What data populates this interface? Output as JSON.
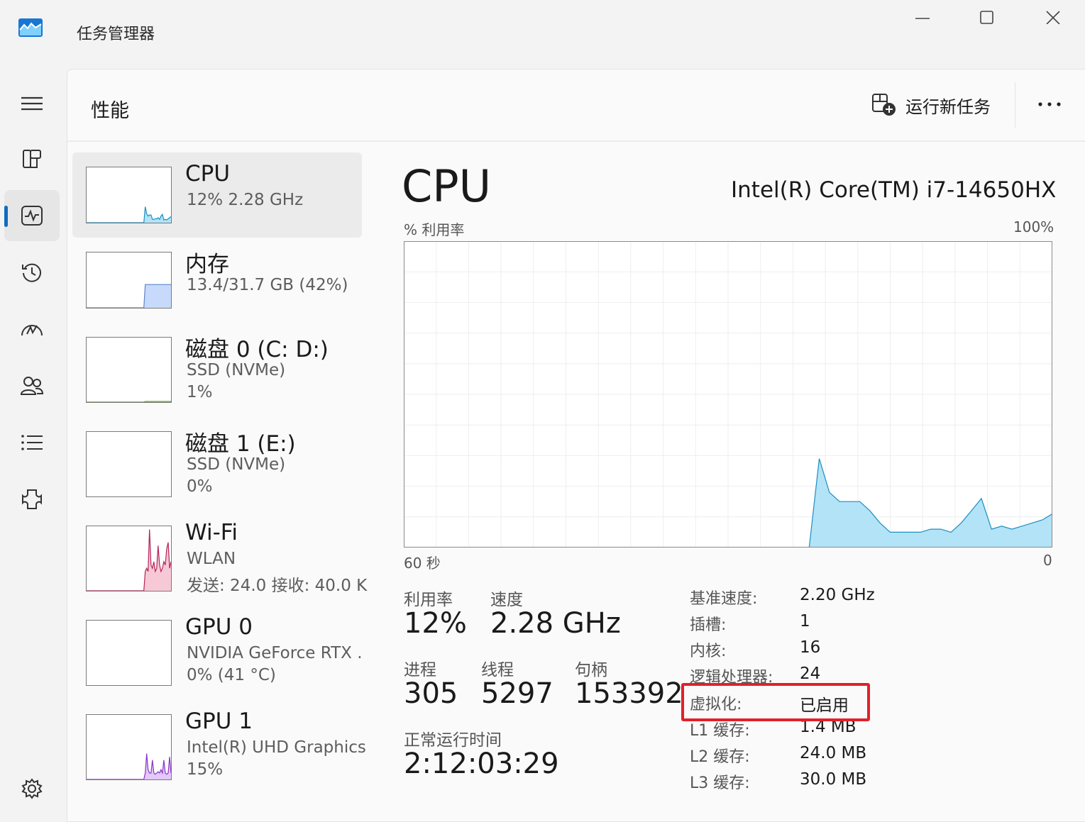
{
  "app": {
    "title": "任务管理器"
  },
  "icons": {
    "app": "task-manager-icon",
    "minimize": "minimize-icon",
    "maximize": "maximize-icon",
    "close": "close-icon",
    "menu": "hamburger-icon",
    "processes": "processes-icon",
    "performance": "performance-icon",
    "history": "app-history-icon",
    "startup": "startup-apps-icon",
    "users": "users-icon",
    "details": "details-icon",
    "services": "services-icon",
    "settings": "gear-icon",
    "run_task": "run-new-task-icon",
    "more": "more-options-icon"
  },
  "colors": {
    "accent": "#0f6cbd",
    "cpu_stroke": "#1c8fc0",
    "cpu_fill": "#b3e3f7",
    "memory_stroke": "#5b86c8",
    "memory_fill": "#c7dafc",
    "disk_stroke": "#4e9a06",
    "wifi_stroke": "#b4245a",
    "wifi_fill": "#f7c9d6",
    "gpu_stroke": "#8a33c7",
    "gpu_fill": "#e3c8f8",
    "highlight": "#e3202a"
  },
  "header": {
    "title": "性能",
    "run_new_task": "运行新任务",
    "more": "···"
  },
  "resources": [
    {
      "name": "CPU",
      "line1": "12%  2.28 GHz",
      "line2": "",
      "selected": true,
      "graph": {
        "kind": "line",
        "values": [
          0,
          0,
          0,
          0,
          0,
          0,
          0,
          0,
          0,
          0,
          0,
          0,
          0,
          0,
          0,
          0,
          0,
          0,
          0,
          0,
          0,
          0,
          0,
          0,
          0,
          0,
          0,
          0,
          0,
          0,
          0,
          0,
          0,
          0,
          0,
          0,
          0,
          0,
          0,
          0,
          0,
          29,
          16,
          12,
          14,
          14,
          6,
          6,
          7,
          7,
          9,
          6,
          12,
          15,
          5,
          6,
          5,
          7,
          9,
          11
        ]
      }
    },
    {
      "name": "内存",
      "line1": "13.4/31.7 GB (42%)",
      "line2": "",
      "selected": false,
      "graph": {
        "kind": "level",
        "values": [
          0,
          0,
          0,
          0,
          0,
          0,
          0,
          0,
          0,
          0,
          0,
          0,
          0,
          0,
          0,
          0,
          0,
          0,
          0,
          0,
          0,
          0,
          0,
          0,
          0,
          0,
          0,
          0,
          0,
          0,
          0,
          0,
          0,
          0,
          0,
          0,
          0,
          0,
          0,
          0,
          0,
          42,
          42,
          42,
          42,
          42,
          42,
          42,
          42,
          42,
          42,
          42,
          42,
          42,
          42,
          42,
          42,
          42,
          42,
          42
        ]
      }
    },
    {
      "name": "磁盘 0 (C: D:)",
      "line1": "SSD (NVMe)",
      "line2": "1%",
      "selected": false,
      "graph": {
        "kind": "line",
        "values": [
          0,
          0,
          0,
          0,
          0,
          0,
          0,
          0,
          0,
          0,
          0,
          0,
          0,
          0,
          0,
          0,
          0,
          0,
          0,
          0,
          0,
          0,
          0,
          0,
          0,
          0,
          0,
          0,
          0,
          0,
          0,
          0,
          0,
          0,
          0,
          0,
          0,
          0,
          0,
          0,
          0,
          1,
          1,
          1,
          1,
          1,
          1,
          1,
          1,
          1,
          1,
          1,
          1,
          1,
          1,
          1,
          1,
          1,
          1,
          1
        ]
      }
    },
    {
      "name": "磁盘 1 (E:)",
      "line1": "SSD (NVMe)",
      "line2": "0%",
      "selected": false,
      "graph": {
        "kind": "line",
        "values": []
      }
    },
    {
      "name": "Wi-Fi",
      "line1": "WLAN",
      "line2": "发送: 24.0 接收: 40.0 K",
      "selected": false,
      "graph": {
        "kind": "line",
        "values": [
          0,
          0,
          0,
          0,
          0,
          0,
          0,
          0,
          0,
          0,
          0,
          0,
          0,
          0,
          0,
          0,
          0,
          0,
          0,
          0,
          0,
          0,
          0,
          0,
          0,
          0,
          0,
          0,
          0,
          0,
          0,
          0,
          0,
          0,
          0,
          0,
          0,
          0,
          0,
          0,
          0,
          30,
          35,
          30,
          95,
          40,
          35,
          45,
          30,
          35,
          70,
          40,
          30,
          35,
          45,
          40,
          65,
          75,
          35,
          45
        ]
      }
    },
    {
      "name": "GPU 0",
      "line1": "NVIDIA GeForce RTX .",
      "line2": "0%  (41 °C)",
      "selected": false,
      "graph": {
        "kind": "line",
        "values": []
      }
    },
    {
      "name": "GPU 1",
      "line1": "Intel(R) UHD Graphics",
      "line2": "15%",
      "selected": false,
      "graph": {
        "kind": "line",
        "values": [
          0,
          0,
          0,
          0,
          0,
          0,
          0,
          0,
          0,
          0,
          0,
          0,
          0,
          0,
          0,
          0,
          0,
          0,
          0,
          0,
          0,
          0,
          0,
          0,
          0,
          0,
          0,
          0,
          0,
          0,
          0,
          0,
          0,
          0,
          0,
          0,
          0,
          0,
          0,
          0,
          0,
          10,
          40,
          15,
          10,
          10,
          30,
          10,
          8,
          10,
          12,
          10,
          15,
          10,
          30,
          10,
          8,
          10,
          35,
          10
        ]
      }
    }
  ],
  "detail": {
    "title": "CPU",
    "model": "Intel(R) Core(TM) i7-14650HX",
    "axis": {
      "top_left": "% 利用率",
      "top_right": "100%",
      "bottom_left": "60 秒",
      "bottom_right": "0"
    },
    "utilization": [
      0,
      0,
      0,
      0,
      0,
      0,
      0,
      0,
      0,
      0,
      0,
      0,
      0,
      0,
      0,
      0,
      0,
      0,
      0,
      0,
      0,
      0,
      0,
      0,
      0,
      0,
      0,
      0,
      0,
      0,
      0,
      0,
      0,
      0,
      0,
      0,
      0,
      0,
      0,
      0,
      0,
      29,
      18,
      15,
      15,
      15,
      12,
      8,
      5,
      5,
      5,
      5,
      6,
      6,
      5,
      8,
      12,
      16,
      6,
      7,
      6,
      7,
      8,
      9,
      11
    ],
    "stats": {
      "utilization": {
        "label": "利用率",
        "value": "12%"
      },
      "speed": {
        "label": "速度",
        "value": "2.28 GHz"
      },
      "processes": {
        "label": "进程",
        "value": "305"
      },
      "threads": {
        "label": "线程",
        "value": "5297"
      },
      "handles": {
        "label": "句柄",
        "value": "153392"
      },
      "uptime": {
        "label": "正常运行时间",
        "value": "2:12:03:29"
      }
    },
    "specs": [
      {
        "label": "基准速度:",
        "value": "2.20 GHz"
      },
      {
        "label": "插槽:",
        "value": "1"
      },
      {
        "label": "内核:",
        "value": "16"
      },
      {
        "label": "逻辑处理器:",
        "value": "24"
      },
      {
        "label": "虚拟化:",
        "value": "已启用",
        "highlighted": true
      },
      {
        "label": "L1 缓存:",
        "value": "1.4 MB"
      },
      {
        "label": "L2 缓存:",
        "value": "24.0 MB"
      },
      {
        "label": "L3 缓存:",
        "value": "30.0 MB"
      }
    ]
  }
}
